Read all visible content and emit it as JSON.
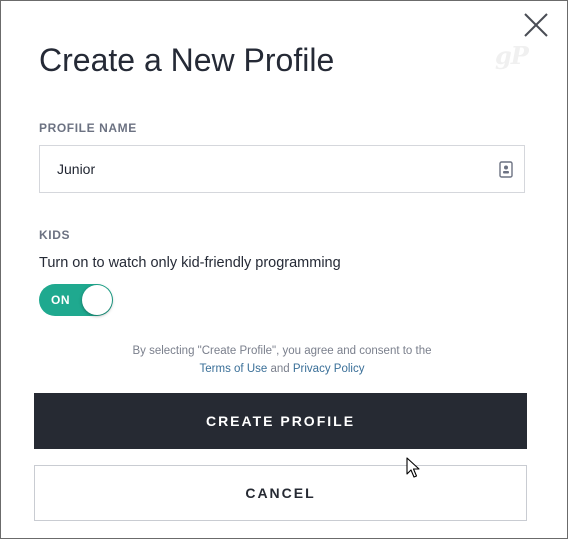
{
  "dialog": {
    "title": "Create a New Profile",
    "close_icon": "close-icon",
    "watermark": "gP"
  },
  "profile_name": {
    "label": "PROFILE NAME",
    "value": "Junior",
    "icon": "contact-card-icon"
  },
  "kids": {
    "label": "KIDS",
    "description": "Turn on to watch only kid-friendly programming",
    "toggle_label": "ON",
    "toggle_state": true,
    "toggle_color": "#1fa98f"
  },
  "consent": {
    "text_prefix": "By selecting \"Create Profile\", you agree and consent to the",
    "terms_link": "Terms of Use",
    "joiner": "and",
    "privacy_link": "Privacy Policy"
  },
  "actions": {
    "create_label": "CREATE PROFILE",
    "cancel_label": "CANCEL",
    "primary_color": "#262a33"
  }
}
